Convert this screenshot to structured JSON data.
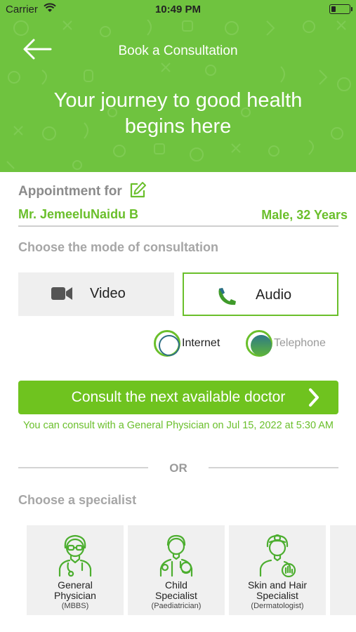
{
  "status_bar": {
    "carrier": "Carrier",
    "time": "10:49 PM"
  },
  "header": {
    "nav_title": "Book a Consultation",
    "hero_line1": "Your journey to good health",
    "hero_line2": "begins here"
  },
  "appointment": {
    "label": "Appointment for",
    "patient_name": "Mr. JemeeluNaidu B",
    "patient_meta": "Male, 32 Years"
  },
  "mode": {
    "heading": "Choose the mode of consultation",
    "video_label": "Video",
    "audio_label": "Audio",
    "selected": "Audio",
    "options": [
      {
        "label": "Internet"
      },
      {
        "label": "Telephone"
      }
    ],
    "selected_option": "Telephone"
  },
  "consult": {
    "button_label": "Consult the next available doctor",
    "note": "You can consult with a General Physician on Jul 15, 2022 at 5:30 AM"
  },
  "or_text": "OR",
  "specialists": {
    "heading": "Choose a specialist",
    "cards": [
      {
        "name_line1": "General",
        "name_line2": "Physician",
        "sub": "(MBBS)",
        "icon": "general-physician-icon"
      },
      {
        "name_line1": "Child",
        "name_line2": "Specialist",
        "sub": "(Paediatrician)",
        "icon": "child-specialist-icon"
      },
      {
        "name_line1": "Skin and Hair",
        "name_line2": "Specialist",
        "sub": "(Dermatologist)",
        "icon": "dermatologist-icon"
      }
    ]
  },
  "colors": {
    "brand_green": "#6fc33f",
    "accent_green": "#6abf2b",
    "muted_text": "#a6a6a6"
  }
}
